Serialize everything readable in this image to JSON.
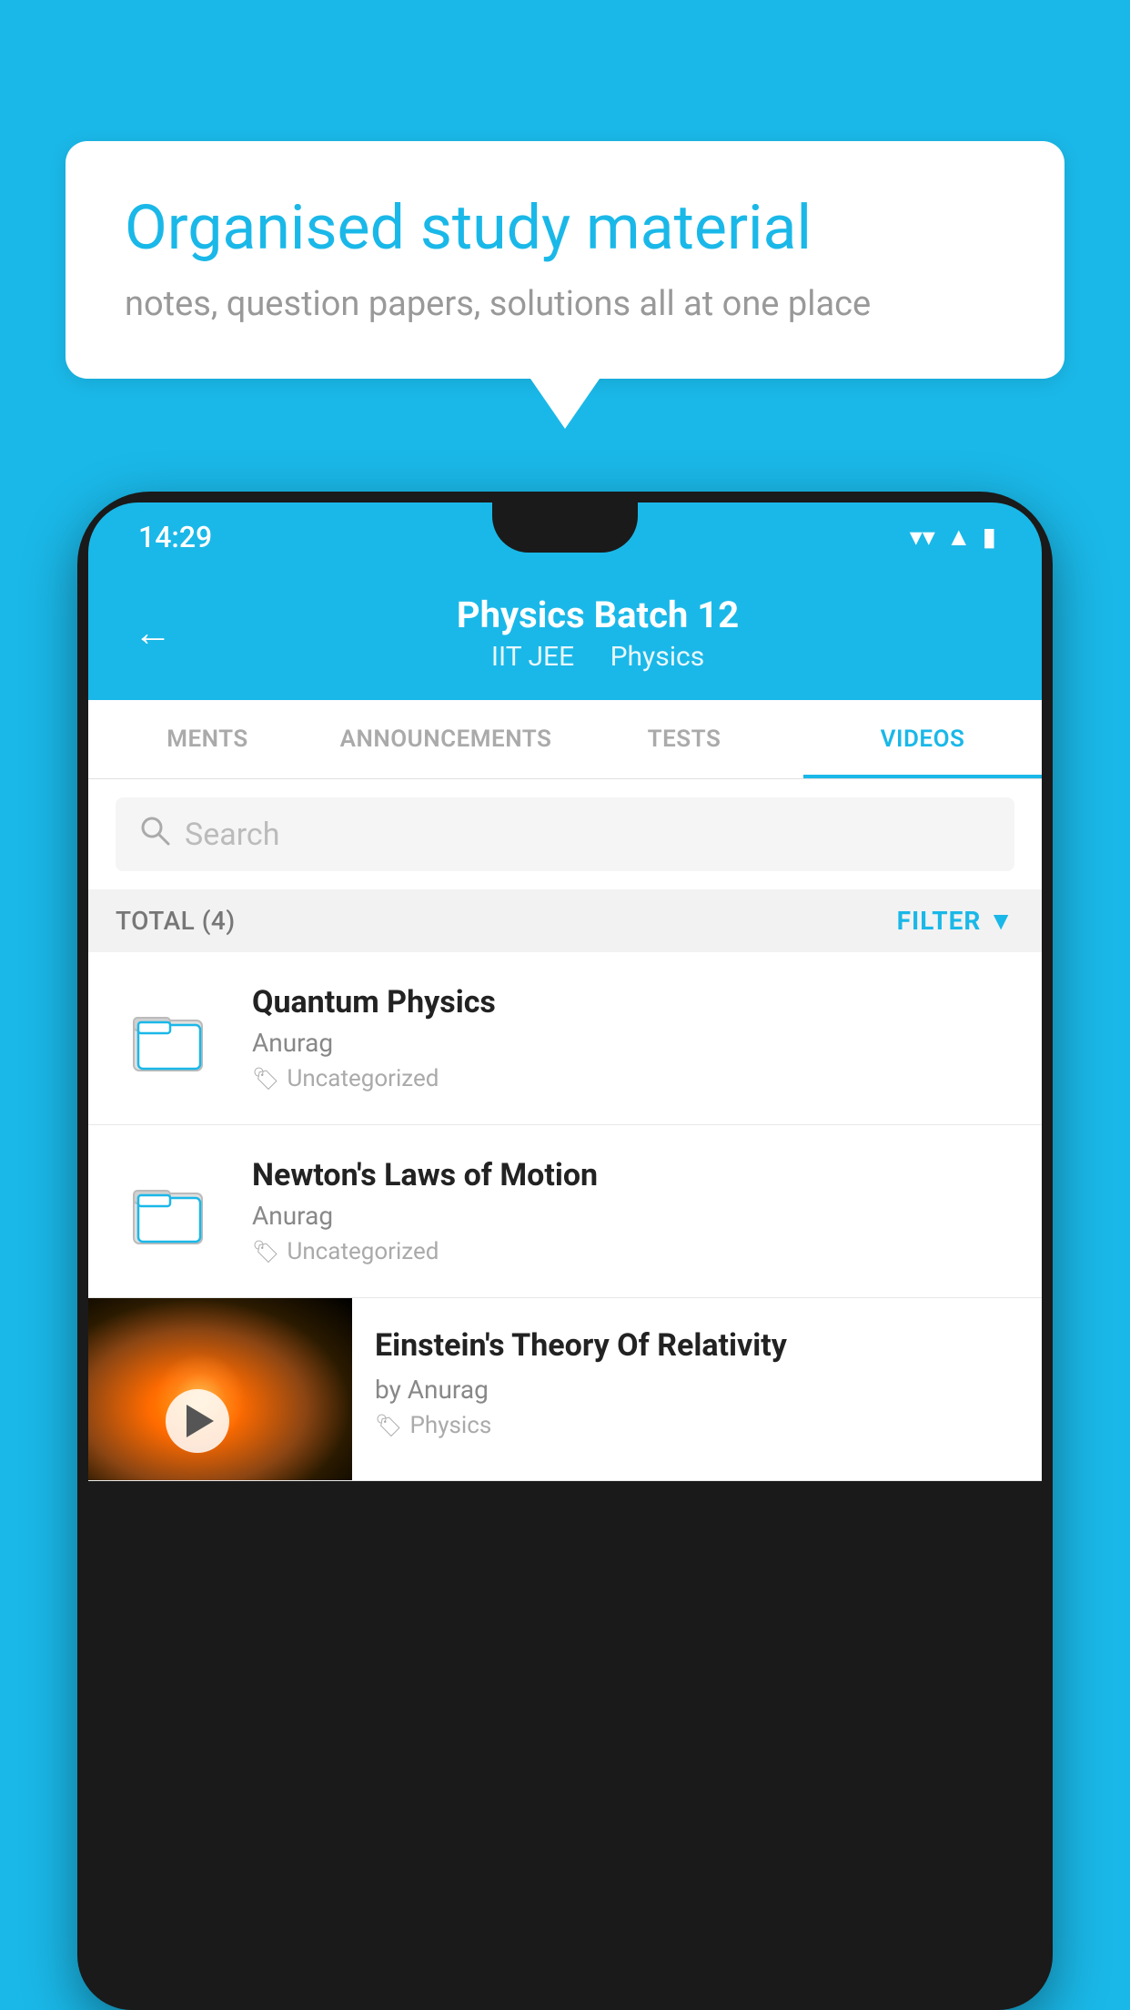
{
  "background_color": "#1ab8e8",
  "bubble": {
    "title": "Organised study material",
    "subtitle": "notes, question papers, solutions all at one place"
  },
  "phone": {
    "status_bar": {
      "time": "14:29"
    },
    "header": {
      "title": "Physics Batch 12",
      "subtitle_part1": "IIT JEE",
      "subtitle_part2": "Physics",
      "back_label": "←"
    },
    "tabs": [
      {
        "label": "MENTS",
        "active": false
      },
      {
        "label": "ANNOUNCEMENTS",
        "active": false
      },
      {
        "label": "TESTS",
        "active": false
      },
      {
        "label": "VIDEOS",
        "active": true
      }
    ],
    "search": {
      "placeholder": "Search"
    },
    "filter_bar": {
      "total_label": "TOTAL (4)",
      "filter_label": "FILTER"
    },
    "videos": [
      {
        "title": "Quantum Physics",
        "author": "Anurag",
        "tag": "Uncategorized",
        "type": "folder"
      },
      {
        "title": "Newton's Laws of Motion",
        "author": "Anurag",
        "tag": "Uncategorized",
        "type": "folder"
      },
      {
        "title": "Einstein's Theory Of Relativity",
        "author": "by Anurag",
        "tag": "Physics",
        "type": "video"
      }
    ]
  }
}
